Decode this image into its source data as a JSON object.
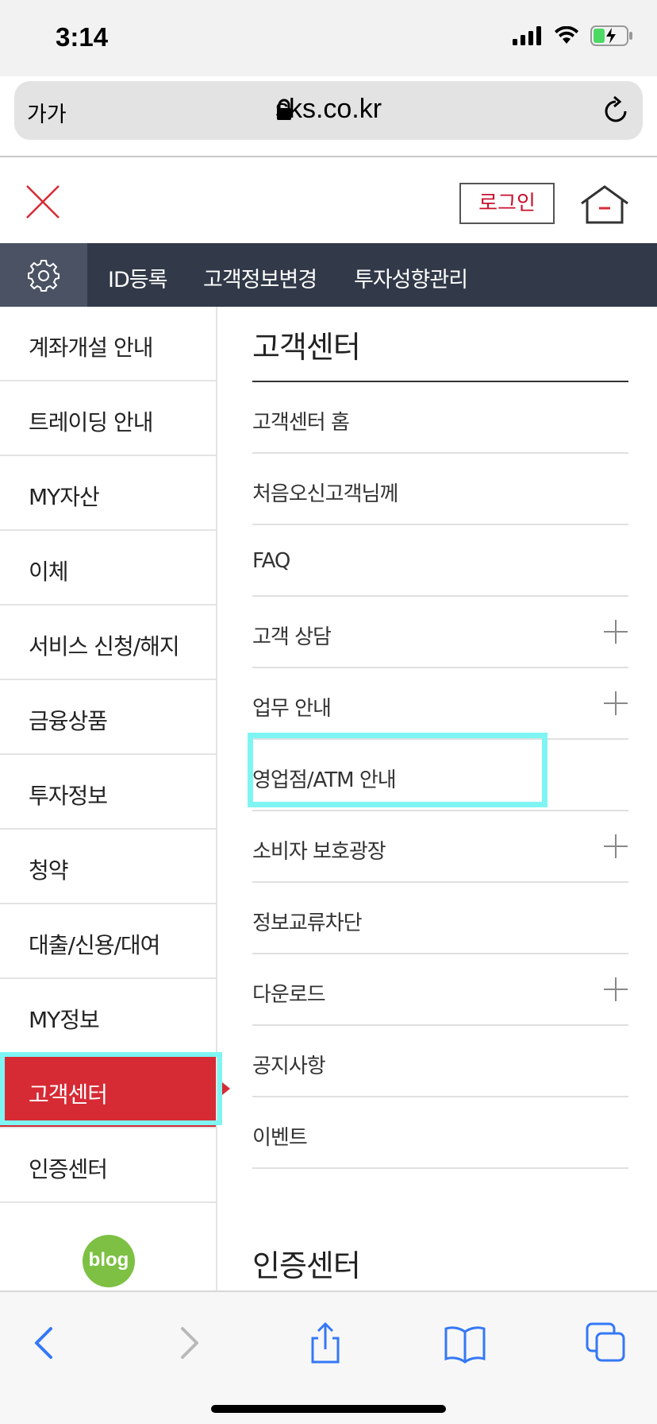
{
  "status": {
    "time": "3:14"
  },
  "browser": {
    "text_size_label": "가가",
    "url": "sks.co.kr"
  },
  "header": {
    "login_label": "로그인"
  },
  "util_nav": {
    "links": [
      "ID등록",
      "고객정보변경",
      "투자성향관리"
    ]
  },
  "left_menu": {
    "items": [
      "계좌개설 안내",
      "트레이딩 안내",
      "MY자산",
      "이체",
      "서비스 신청/해지",
      "금융상품",
      "투자정보",
      "청약",
      "대출/신용/대여",
      "MY정보",
      "고객센터",
      "인증센터"
    ],
    "active_item": "고객센터",
    "blog_label": "blog"
  },
  "right_panel": {
    "section_title": "고객센터",
    "items": [
      {
        "label": "고객센터 홈",
        "expandable": false
      },
      {
        "label": "처음오신고객님께",
        "expandable": false
      },
      {
        "label": "FAQ",
        "expandable": false
      },
      {
        "label": "고객 상담",
        "expandable": true
      },
      {
        "label": "업무 안내",
        "expandable": true
      },
      {
        "label": "영업점/ATM 안내",
        "expandable": false
      },
      {
        "label": "소비자 보호광장",
        "expandable": true
      },
      {
        "label": "정보교류차단",
        "expandable": false
      },
      {
        "label": "다운로드",
        "expandable": true
      },
      {
        "label": "공지사항",
        "expandable": false
      },
      {
        "label": "이벤트",
        "expandable": false
      }
    ],
    "next_section_title": "인증센터"
  },
  "colors": {
    "accent_red": "#d62b35",
    "nav_dark": "#323a49",
    "highlight_cyan": "#7ff5f3",
    "safari_blue": "#3478f6"
  }
}
